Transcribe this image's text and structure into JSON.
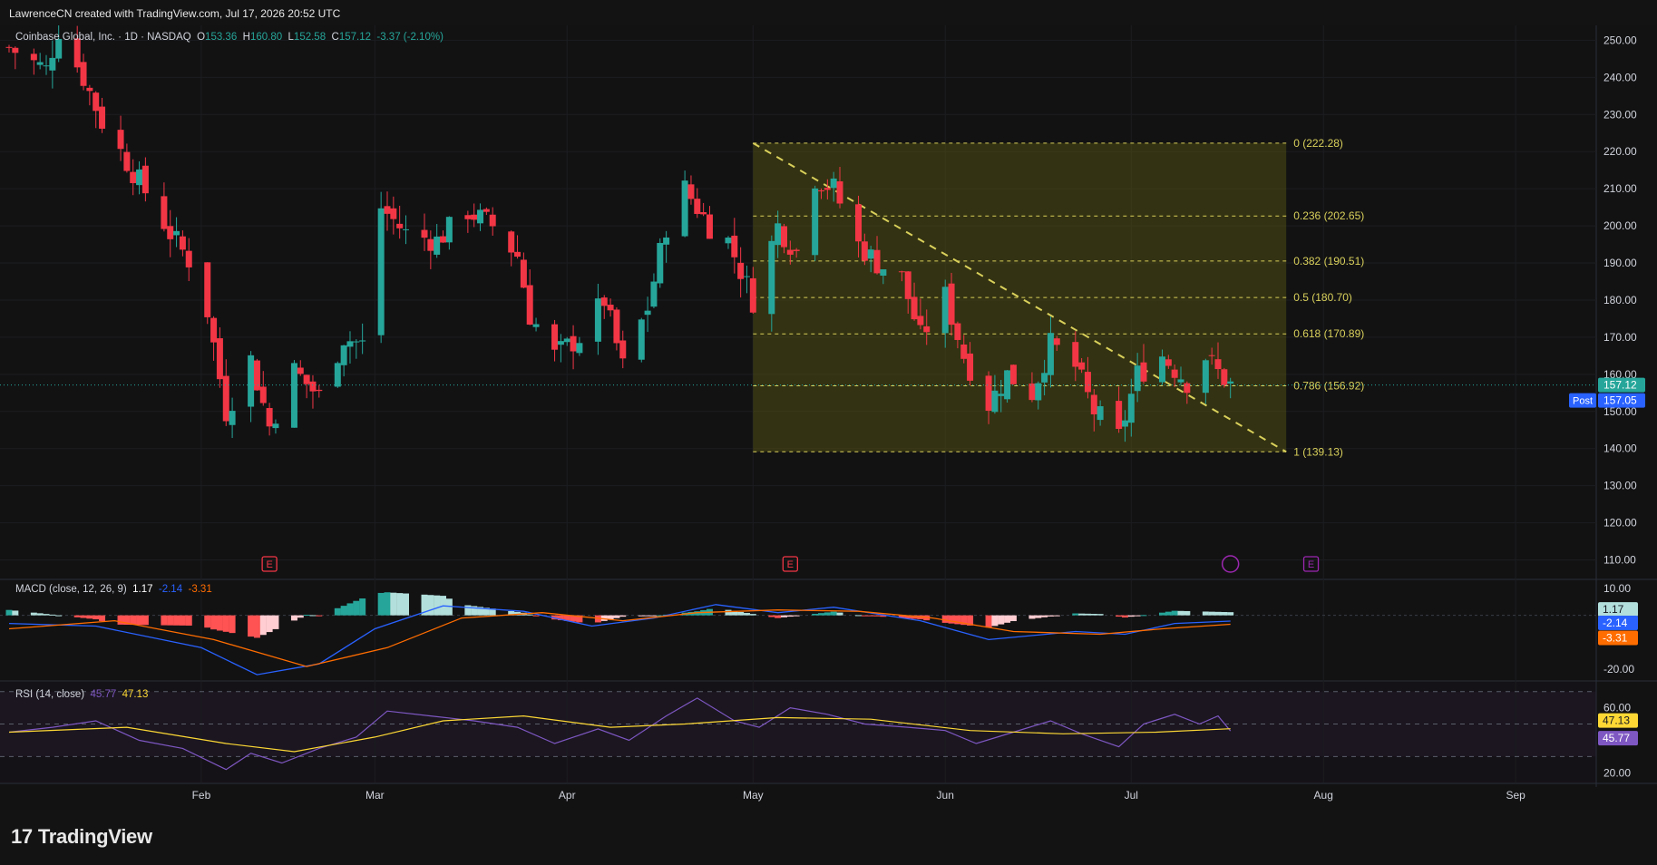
{
  "watermark": "LawrenceCN created with TradingView.com, Jul 17, 2026 20:52 UTC",
  "brand": "TradingView",
  "symbol": {
    "name": "Coinbase Global, Inc.",
    "interval": "1D",
    "exchange": "NASDAQ",
    "open_label": "O",
    "open": "153.36",
    "high_label": "H",
    "high": "160.80",
    "low_label": "L",
    "low": "152.58",
    "close_label": "C",
    "close": "157.12",
    "change": "-3.37 (-2.10%)"
  },
  "price_tags": {
    "last": "157.12",
    "post_label": "Post",
    "post": "157.05"
  },
  "earnings_marker": "E",
  "colors": {
    "up": "#26a69a",
    "down": "#f23645",
    "fib": "#d9d05b",
    "macd": "#2962ff",
    "signal": "#ff6d00",
    "rsi": "#7e57c2",
    "rsi_ma": "#fdd835"
  },
  "chart_data": [
    {
      "type": "candlestick",
      "title": "Coinbase Global, Inc. · 1D · NASDAQ",
      "x_ticks": [
        "Feb",
        "Mar",
        "Apr",
        "May",
        "Jun",
        "Jul",
        "Aug",
        "Sep"
      ],
      "y_ticks": [
        "250.00",
        "240.00",
        "230.00",
        "220.00",
        "210.00",
        "200.00",
        "190.00",
        "180.00",
        "170.00",
        "160.00",
        "150.00",
        "140.00",
        "130.00",
        "120.00",
        "110.00"
      ],
      "ylim": [
        105,
        254
      ],
      "y_ticks_values": [
        250,
        240,
        230,
        220,
        210,
        200,
        190,
        180,
        170,
        160,
        150,
        140,
        130,
        120,
        110
      ],
      "x_tick_dates": [
        "2026-02-01",
        "2026-03-01",
        "2026-04-01",
        "2026-05-01",
        "2026-06-01",
        "2026-07-01",
        "2026-08-01",
        "2026-09-01"
      ],
      "x_range": [
        "2026-01-01",
        "2026-09-14"
      ],
      "close_path": [
        [
          "2026-01-01",
          248
        ],
        [
          "2026-01-07",
          242
        ],
        [
          "2026-01-09",
          253
        ],
        [
          "2026-01-13",
          240
        ],
        [
          "2026-01-16",
          228
        ],
        [
          "2026-01-22",
          212
        ],
        [
          "2026-01-27",
          198
        ],
        [
          "2026-02-01",
          186
        ],
        [
          "2026-02-05",
          150
        ],
        [
          "2026-02-09",
          164
        ],
        [
          "2026-02-12",
          146
        ],
        [
          "2026-02-16",
          161
        ],
        [
          "2026-02-20",
          154
        ],
        [
          "2026-02-24",
          170
        ],
        [
          "2026-02-27",
          168
        ],
        [
          "2026-03-02",
          205
        ],
        [
          "2026-03-06",
          198
        ],
        [
          "2026-03-11",
          196
        ],
        [
          "2026-03-16",
          204
        ],
        [
          "2026-03-20",
          200
        ],
        [
          "2026-03-24",
          192
        ],
        [
          "2026-03-26",
          176
        ],
        [
          "2026-03-30",
          165
        ],
        [
          "2026-04-03",
          170
        ],
        [
          "2026-04-07",
          180
        ],
        [
          "2026-04-10",
          162
        ],
        [
          "2026-04-14",
          178
        ],
        [
          "2026-04-17",
          200
        ],
        [
          "2026-04-20",
          210
        ],
        [
          "2026-04-24",
          200
        ],
        [
          "2026-04-27",
          196
        ],
        [
          "2026-05-01",
          180
        ],
        [
          "2026-05-05",
          200
        ],
        [
          "2026-05-08",
          193
        ],
        [
          "2026-05-11",
          213
        ],
        [
          "2026-05-14",
          210
        ],
        [
          "2026-05-18",
          195
        ],
        [
          "2026-05-21",
          190
        ],
        [
          "2026-05-25",
          186
        ],
        [
          "2026-05-28",
          170
        ],
        [
          "2026-06-01",
          181
        ],
        [
          "2026-06-04",
          165
        ],
        [
          "2026-06-08",
          152
        ],
        [
          "2026-06-11",
          160
        ],
        [
          "2026-06-15",
          155
        ],
        [
          "2026-06-18",
          168
        ],
        [
          "2026-06-22",
          162
        ],
        [
          "2026-06-25",
          150
        ],
        [
          "2026-06-29",
          143
        ],
        [
          "2026-07-02",
          160
        ],
        [
          "2026-07-06",
          165
        ],
        [
          "2026-07-10",
          158
        ],
        [
          "2026-07-13",
          165
        ],
        [
          "2026-07-15",
          160.49
        ],
        [
          "2026-07-17",
          157.12
        ]
      ],
      "fibonacci": {
        "start": "2026-05-01",
        "end": "2026-07-26",
        "levels": [
          {
            "label": "0 (222.28)",
            "value": 222.28
          },
          {
            "label": "0.236 (202.65)",
            "value": 202.65
          },
          {
            "label": "0.382 (190.51)",
            "value": 190.51
          },
          {
            "label": "0.5 (180.70)",
            "value": 180.7
          },
          {
            "label": "0.618 (170.89)",
            "value": 170.89
          },
          {
            "label": "0.786 (156.92)",
            "value": 156.92
          },
          {
            "label": "1 (139.13)",
            "value": 139.13
          }
        ]
      },
      "trendline": {
        "from": [
          "2026-05-01",
          222.28
        ],
        "to": [
          "2026-07-26",
          139.13
        ]
      },
      "earnings_dates": [
        "2026-02-12",
        "2026-05-07",
        "2026-07-30"
      ],
      "event_date": "2026-07-17"
    },
    {
      "type": "line",
      "title": "MACD (close, 12, 26, 9)",
      "values_shown": {
        "histogram": "1.17",
        "macd": "-2.14",
        "signal": "-3.31"
      },
      "y_ticks": [
        "10.00",
        "-20.00"
      ],
      "y_ticks_values": [
        10,
        -20
      ],
      "ylim": [
        -24,
        13
      ],
      "macd_path": [
        [
          "2026-01-01",
          -3
        ],
        [
          "2026-01-15",
          -4
        ],
        [
          "2026-02-01",
          -12
        ],
        [
          "2026-02-10",
          -22
        ],
        [
          "2026-02-20",
          -18
        ],
        [
          "2026-03-01",
          -5
        ],
        [
          "2026-03-12",
          3.5
        ],
        [
          "2026-03-25",
          1.5
        ],
        [
          "2026-04-05",
          -4
        ],
        [
          "2026-04-15",
          -1
        ],
        [
          "2026-04-25",
          4
        ],
        [
          "2026-05-05",
          1
        ],
        [
          "2026-05-14",
          3
        ],
        [
          "2026-05-28",
          -2
        ],
        [
          "2026-06-08",
          -9
        ],
        [
          "2026-06-22",
          -6
        ],
        [
          "2026-06-30",
          -7
        ],
        [
          "2026-07-08",
          -3
        ],
        [
          "2026-07-17",
          -2.14
        ]
      ],
      "signal_path": [
        [
          "2026-01-01",
          -5
        ],
        [
          "2026-01-18",
          -2
        ],
        [
          "2026-02-03",
          -9
        ],
        [
          "2026-02-18",
          -19
        ],
        [
          "2026-03-03",
          -12
        ],
        [
          "2026-03-15",
          -1
        ],
        [
          "2026-03-28",
          1
        ],
        [
          "2026-04-10",
          -2
        ],
        [
          "2026-04-22",
          1
        ],
        [
          "2026-05-05",
          2
        ],
        [
          "2026-05-18",
          1.5
        ],
        [
          "2026-05-30",
          -1
        ],
        [
          "2026-06-12",
          -6
        ],
        [
          "2026-06-26",
          -7
        ],
        [
          "2026-07-06",
          -5
        ],
        [
          "2026-07-17",
          -3.31
        ]
      ],
      "histogram_note": "histogram = macd - signal"
    },
    {
      "type": "line",
      "title": "RSI (14, close)",
      "values_shown": {
        "rsi": "45.77",
        "rsi_ma": "47.13"
      },
      "y_ticks": [
        "60.00",
        "40.00",
        "20.00"
      ],
      "y_ticks_values": [
        60,
        40,
        20
      ],
      "bands": [
        70,
        50,
        30
      ],
      "ylim": [
        14,
        76
      ],
      "rsi_path": [
        [
          "2026-01-01",
          45
        ],
        [
          "2026-01-08",
          48
        ],
        [
          "2026-01-15",
          52
        ],
        [
          "2026-01-22",
          40
        ],
        [
          "2026-01-29",
          35
        ],
        [
          "2026-02-05",
          22
        ],
        [
          "2026-02-09",
          32
        ],
        [
          "2026-02-14",
          26
        ],
        [
          "2026-02-20",
          35
        ],
        [
          "2026-02-26",
          42
        ],
        [
          "2026-03-03",
          58
        ],
        [
          "2026-03-10",
          55
        ],
        [
          "2026-03-17",
          52
        ],
        [
          "2026-03-24",
          48
        ],
        [
          "2026-03-30",
          38
        ],
        [
          "2026-04-06",
          47
        ],
        [
          "2026-04-11",
          40
        ],
        [
          "2026-04-17",
          55
        ],
        [
          "2026-04-22",
          66
        ],
        [
          "2026-04-28",
          52
        ],
        [
          "2026-05-02",
          48
        ],
        [
          "2026-05-07",
          60
        ],
        [
          "2026-05-13",
          56
        ],
        [
          "2026-05-19",
          50
        ],
        [
          "2026-05-26",
          48
        ],
        [
          "2026-06-01",
          46
        ],
        [
          "2026-06-06",
          38
        ],
        [
          "2026-06-12",
          45
        ],
        [
          "2026-06-18",
          52
        ],
        [
          "2026-06-23",
          44
        ],
        [
          "2026-06-29",
          36
        ],
        [
          "2026-07-03",
          50
        ],
        [
          "2026-07-08",
          56
        ],
        [
          "2026-07-12",
          50
        ],
        [
          "2026-07-15",
          55
        ],
        [
          "2026-07-17",
          45.77
        ]
      ],
      "rsi_ma_path": [
        [
          "2026-01-01",
          45
        ],
        [
          "2026-01-20",
          48
        ],
        [
          "2026-02-05",
          38
        ],
        [
          "2026-02-16",
          33
        ],
        [
          "2026-03-01",
          42
        ],
        [
          "2026-03-12",
          52
        ],
        [
          "2026-03-25",
          55
        ],
        [
          "2026-04-08",
          48
        ],
        [
          "2026-04-20",
          50
        ],
        [
          "2026-05-05",
          54
        ],
        [
          "2026-05-20",
          53
        ],
        [
          "2026-06-05",
          46
        ],
        [
          "2026-06-20",
          44
        ],
        [
          "2026-07-05",
          45
        ],
        [
          "2026-07-17",
          47.13
        ]
      ]
    }
  ]
}
